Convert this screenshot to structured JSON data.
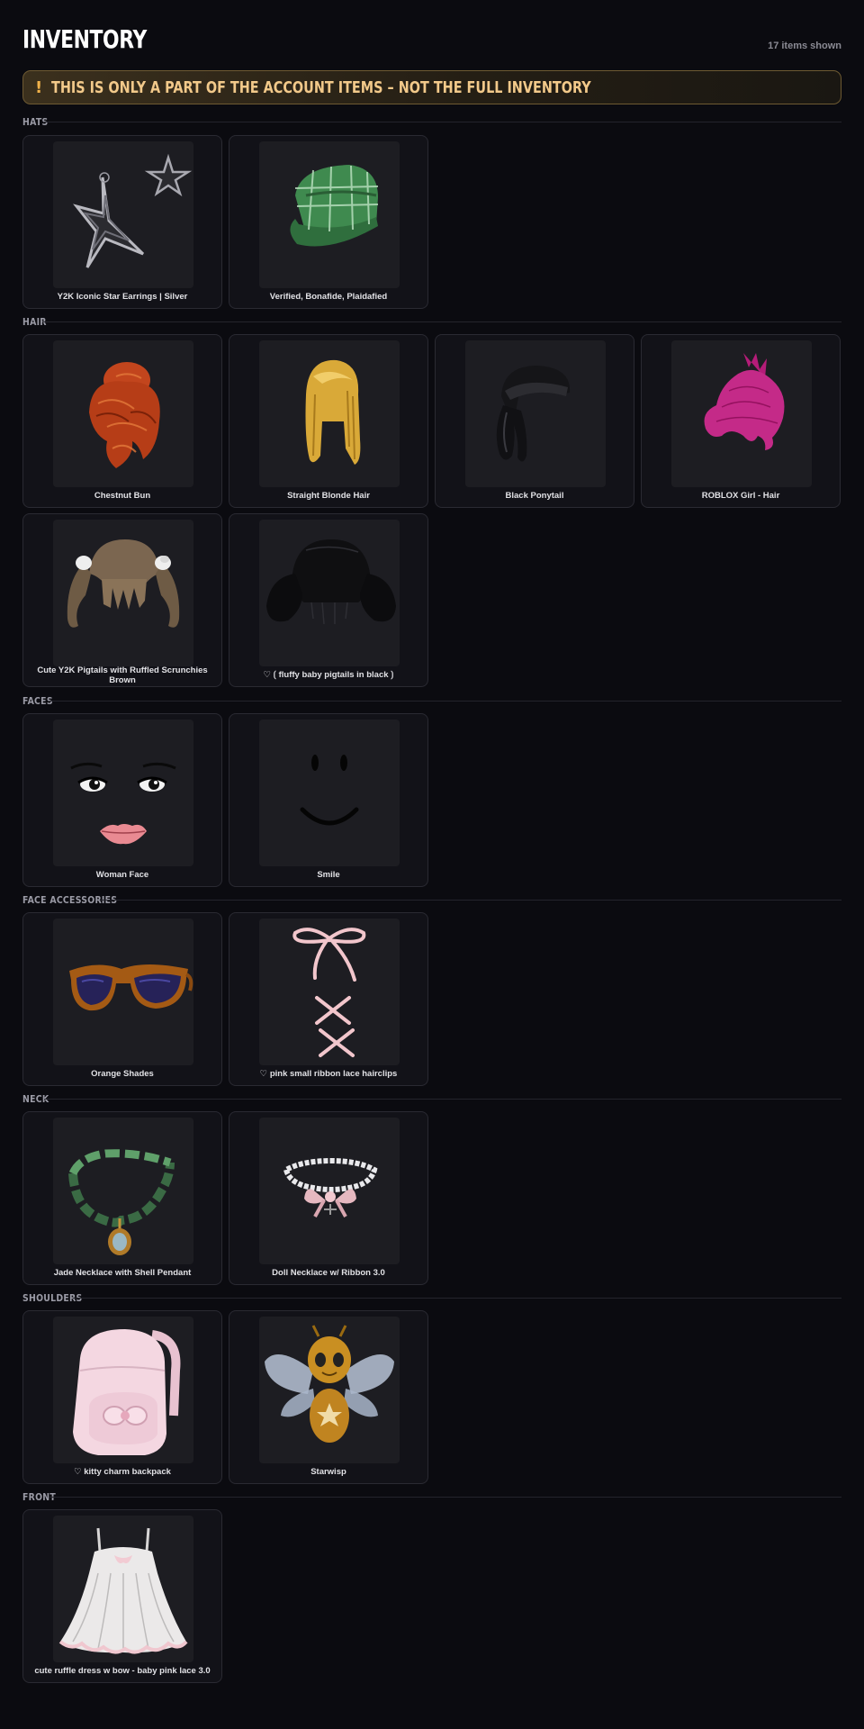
{
  "header": {
    "title": "INVENTORY",
    "count": "17 items shown"
  },
  "banner": {
    "icon": "!",
    "text": "THIS IS ONLY A PART OF THE ACCOUNT ITEMS – NOT THE FULL INVENTORY",
    "accent": "#f0b24a"
  },
  "sections": {
    "hats": {
      "label": "HATS",
      "items": [
        {
          "name": "Y2K Iconic Star Earrings | Silver",
          "icon": "star-earrings-icon"
        },
        {
          "name": "Verified, Bonafide, Plaidafied",
          "icon": "plaid-cap-icon"
        }
      ]
    },
    "hair": {
      "label": "HAIR",
      "items": [
        {
          "name": "Chestnut Bun",
          "icon": "chestnut-bun-hair-icon"
        },
        {
          "name": "Straight Blonde Hair",
          "icon": "blonde-hair-icon"
        },
        {
          "name": "Black Ponytail",
          "icon": "black-ponytail-icon"
        },
        {
          "name": "ROBLOX Girl - Hair",
          "icon": "pink-hair-icon"
        },
        {
          "name": "Cute Y2K Pigtails with Ruffled Scrunchies Brown",
          "icon": "brown-pigtails-icon"
        },
        {
          "name": "♡ ⟮ fluffy baby pigtails in black ⟯",
          "icon": "black-pigtails-icon"
        }
      ]
    },
    "faces": {
      "label": "FACES",
      "items": [
        {
          "name": "Woman Face",
          "icon": "woman-face-icon"
        },
        {
          "name": "Smile",
          "icon": "smile-face-icon"
        }
      ]
    },
    "face_accessories": {
      "label": "FACE ACCESSORIES",
      "items": [
        {
          "name": "Orange Shades",
          "icon": "orange-shades-icon"
        },
        {
          "name": "♡ pink small ribbon lace hairclips",
          "icon": "ribbon-hairclips-icon"
        }
      ]
    },
    "neck": {
      "label": "NECK",
      "items": [
        {
          "name": "Jade Necklace with Shell Pendant",
          "icon": "jade-necklace-icon"
        },
        {
          "name": "Doll Necklace w/ Ribbon 3.0",
          "icon": "doll-necklace-icon"
        }
      ]
    },
    "shoulders": {
      "label": "SHOULDERS",
      "items": [
        {
          "name": "♡ kitty charm backpack",
          "icon": "kitty-backpack-icon"
        },
        {
          "name": "Starwisp",
          "icon": "starwisp-bee-icon"
        }
      ]
    },
    "front": {
      "label": "FRONT",
      "items": [
        {
          "name": "cute ruffle dress w bow - baby pink lace 3.0",
          "icon": "ruffle-dress-icon"
        }
      ]
    }
  }
}
